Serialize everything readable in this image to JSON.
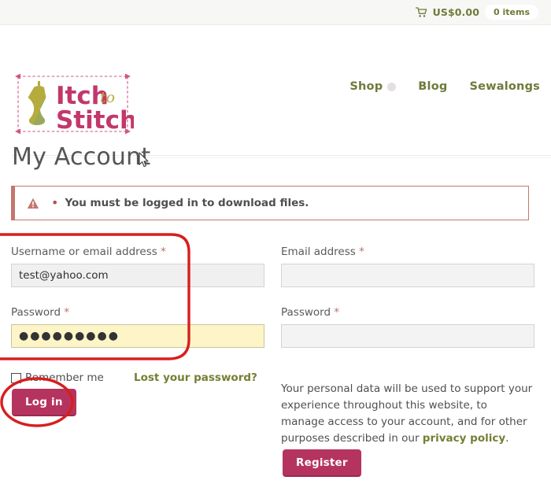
{
  "topbar": {
    "cart_icon": "shopping-cart-icon",
    "cart_total": "US$0.00",
    "cart_count": "0 items"
  },
  "header": {
    "logo": {
      "line1": "Itch",
      "script": "to",
      "line2": "Stitch",
      "alt": "Itch to Stitch logo"
    },
    "nav": [
      {
        "label": "Shop",
        "has_dropdown": true
      },
      {
        "label": "Blog",
        "has_dropdown": false
      },
      {
        "label": "Sewalongs",
        "has_dropdown": false
      }
    ]
  },
  "page": {
    "title": "My Account"
  },
  "notice": {
    "icon": "warning-triangle-icon",
    "bullet": "•",
    "message": "You must be logged in to download files."
  },
  "login": {
    "username_label": "Username or email address",
    "username_value": "test@yahoo.com",
    "username_placeholder": "",
    "password_label": "Password",
    "password_value": "●●●●●●●●●",
    "password_placeholder": "",
    "required_mark": "*",
    "remember_label": "Remember me",
    "lost_password_label": "Lost your password?",
    "submit_label": "Log in"
  },
  "register": {
    "email_label": "Email address",
    "email_value": "",
    "email_placeholder": "",
    "password_label": "Password",
    "password_value": "",
    "password_placeholder": "",
    "required_mark": "*",
    "privacy_text_before": "Your personal data will be used to support your experience throughout this website, to manage access to your account, and for other purposes described in our ",
    "privacy_link_label": "privacy policy",
    "privacy_text_after": ".",
    "submit_label": "Register"
  },
  "colors": {
    "brand_crimson": "#b5345f",
    "brand_olive": "#6d7b3a",
    "notice_red": "#c4756c",
    "annotation_red": "#d81e1e",
    "autofill_yellow": "#fdf5c8"
  },
  "annotations": [
    {
      "name": "login-fields-highlight",
      "shape": "rounded-rect"
    },
    {
      "name": "login-button-highlight",
      "shape": "ellipse"
    }
  ]
}
